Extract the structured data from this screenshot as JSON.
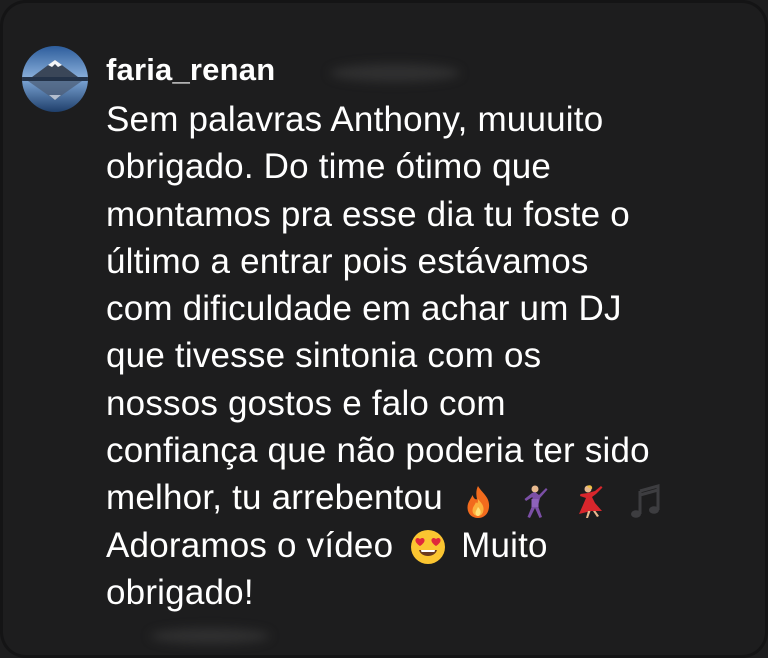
{
  "comment": {
    "username": "faria_renan",
    "lines": [
      "Sem palavras Anthony, muuuito",
      "obrigado. Do time ótimo que",
      "montamos pra esse dia tu foste o",
      "último a entrar pois estávamos",
      "com dificuldade em achar um DJ",
      "que tivesse sintonia com os",
      "nossos gostos e falo com",
      "confiança que não poderia ter sido",
      "melhor, tu arrebentou"
    ],
    "line10_before_emoji": "Adoramos o vídeo",
    "line10_after_emoji": "Muito",
    "last_line": "obrigado!"
  },
  "emojis": {
    "row_after_line9": [
      "fire-icon",
      "man-dancing-icon",
      "woman-dancing-icon",
      "musical-notes-icon"
    ],
    "inline_line10": "heart-eyes-face-icon"
  },
  "colors": {
    "background": "#1d1d1e",
    "text": "#ffffff"
  }
}
